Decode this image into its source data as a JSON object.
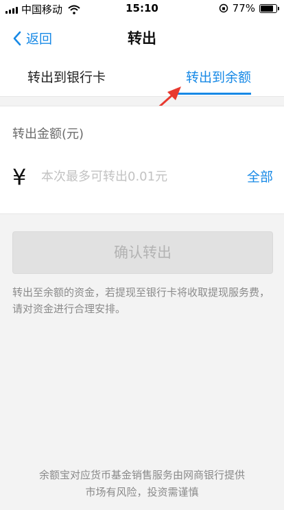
{
  "status_bar": {
    "carrier": "中国移动",
    "time": "15:10",
    "battery": "77%",
    "battery_level": 0.77
  },
  "nav": {
    "back_label": "返回",
    "title": "转出"
  },
  "tabs": [
    {
      "label": "转出到银行卡"
    },
    {
      "label": "转出到余额"
    }
  ],
  "form": {
    "amount_label": "转出金额(元)",
    "currency_symbol": "¥",
    "amount_placeholder": "本次最多可转出0.01元",
    "all_label": "全部"
  },
  "confirm_button": {
    "label": "确认转出"
  },
  "notice": "转出至余额的资金，若提现至银行卡将收取提现服务费，请对资金进行合理安排。",
  "footer": {
    "line1": "余额宝对应货币基金销售服务由网商银行提供",
    "line2": "市场有风险，投资需谨慎"
  },
  "colors": {
    "accent": "#1789e6",
    "annotation_arrow": "#e8392f"
  }
}
